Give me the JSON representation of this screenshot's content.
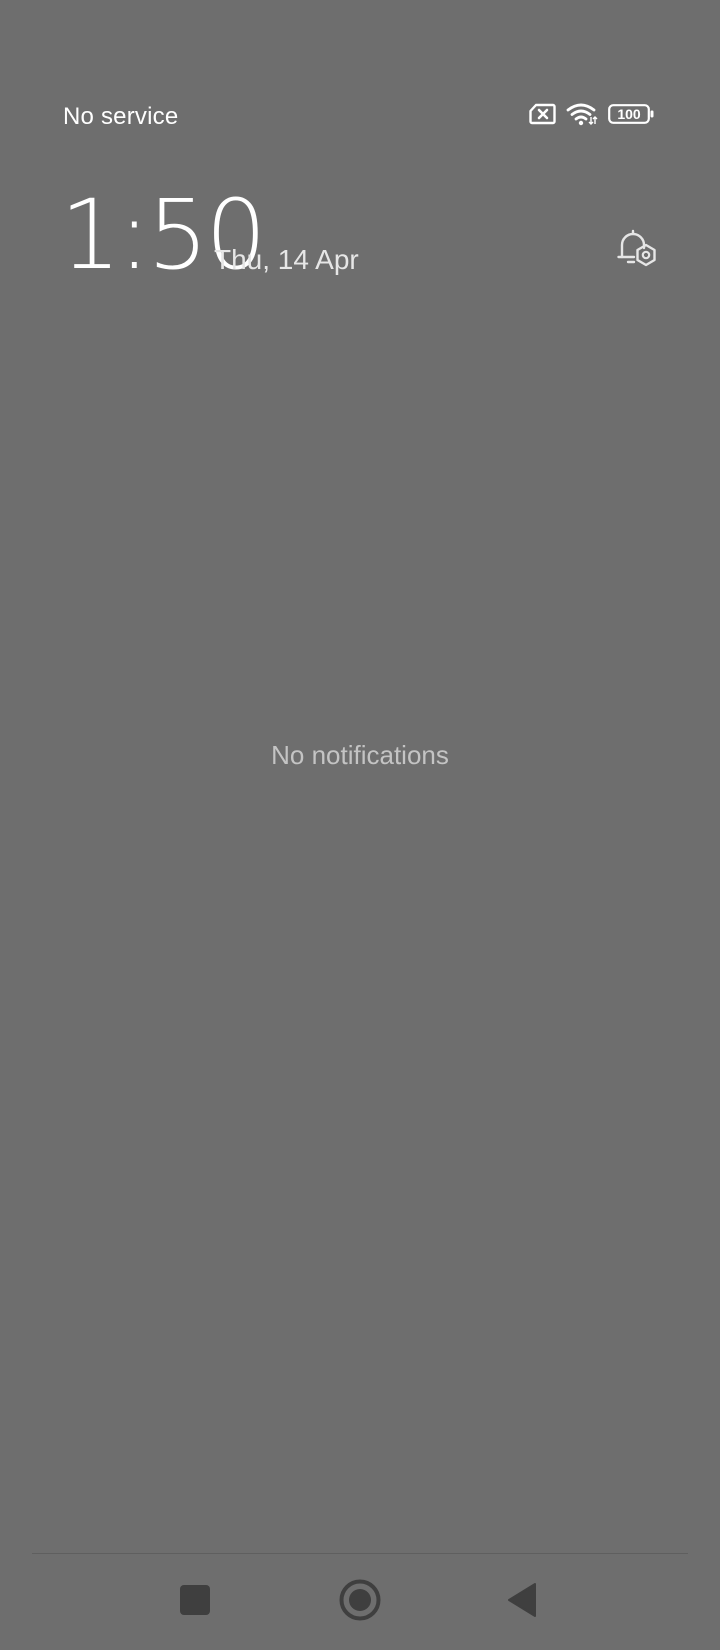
{
  "status_bar": {
    "carrier": "No service",
    "icons": [
      "no-sim-icon",
      "wifi-icon",
      "battery-icon"
    ],
    "battery_level": "100"
  },
  "header": {
    "time": "1:50",
    "date": "Thu, 14 Apr",
    "settings_icon": "notification-settings-icon"
  },
  "notifications": {
    "empty_message": "No notifications"
  },
  "nav_bar": {
    "buttons": [
      "recents-icon",
      "home-icon",
      "back-icon"
    ]
  },
  "colors": {
    "background": "#6e6e6e",
    "primary_text": "#ffffff",
    "secondary_text": "#c4c4c4",
    "nav_icons": "#3f3f3f"
  }
}
